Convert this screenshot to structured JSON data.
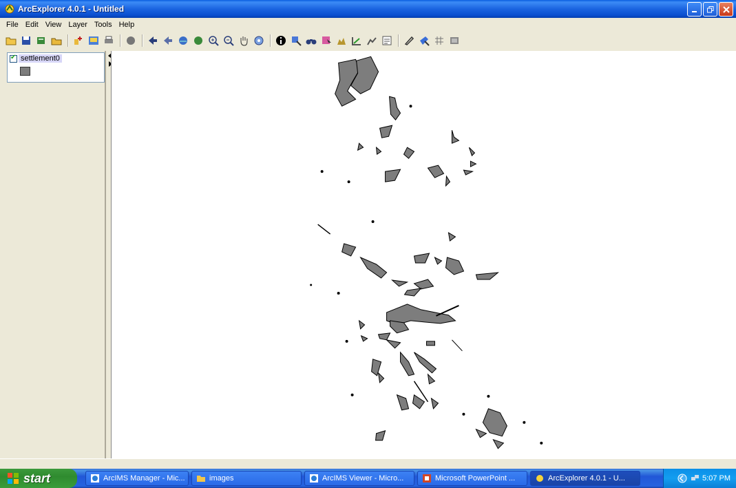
{
  "window": {
    "title": "ArcExplorer 4.0.1 - Untitled"
  },
  "menu": [
    "File",
    "Edit",
    "View",
    "Layer",
    "Tools",
    "Help"
  ],
  "toc": {
    "layer_name": "settlement0",
    "layer_visible": true,
    "fill_color": "#7d7d7d"
  },
  "taskbar": {
    "start_label": "start",
    "tasks": [
      {
        "label": "ArcIMS Manager - Mic..."
      },
      {
        "label": "images"
      },
      {
        "label": "ArcIMS Viewer - Micro..."
      },
      {
        "label": "Microsoft PowerPoint ..."
      },
      {
        "label": "ArcExplorer 4.0.1 - U..."
      }
    ],
    "clock": "5:07 PM"
  },
  "colors": {
    "title_bar": "#0a5ee0",
    "map_bg": "#ffffff",
    "polygon_fill": "#7d7d7d"
  }
}
